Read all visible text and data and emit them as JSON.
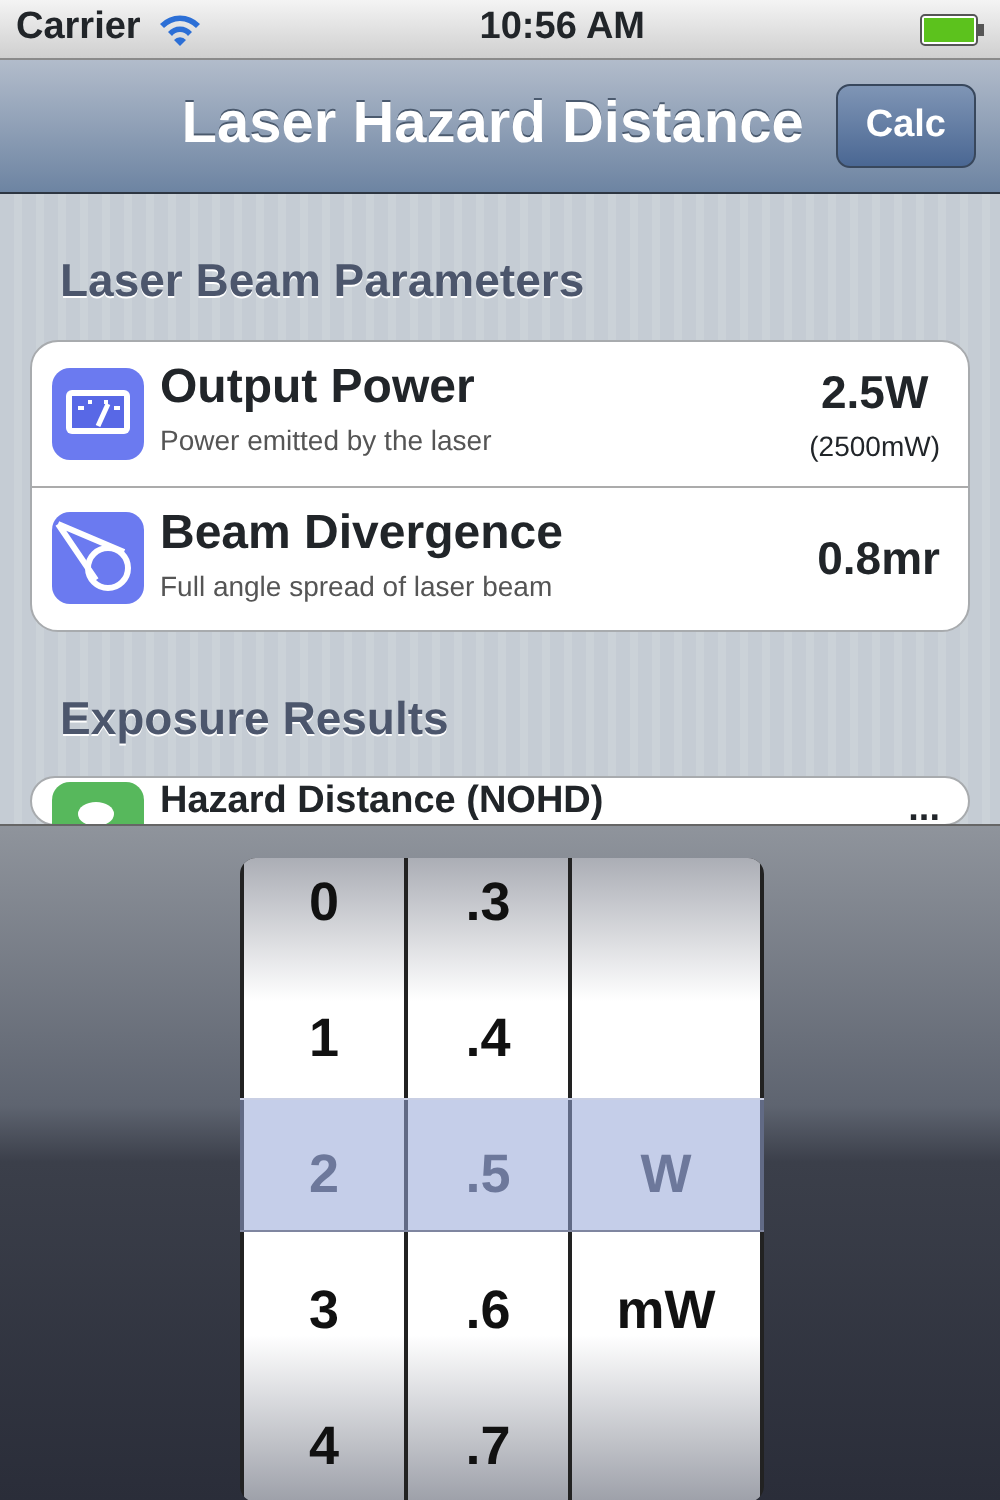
{
  "status_bar": {
    "carrier": "Carrier",
    "time": "10:56 AM"
  },
  "nav": {
    "title": "Laser Hazard Distance",
    "button": "Calc"
  },
  "sections": [
    {
      "header": "Laser Beam Parameters",
      "rows": [
        {
          "title": "Output Power",
          "subtitle": "Power emitted by the laser",
          "value": "2.5W",
          "value_note": "(2500mW)"
        },
        {
          "title": "Beam Divergence",
          "subtitle": "Full angle spread of laser beam",
          "value": "0.8mr"
        }
      ]
    },
    {
      "header": "Exposure Results",
      "rows": [
        {
          "title": "Hazard Distance (NOHD)",
          "value": "..."
        }
      ]
    }
  ],
  "picker": {
    "columns": [
      {
        "items": [
          {
            "label": "0",
            "selected": false
          },
          {
            "label": "1",
            "selected": false
          },
          {
            "label": "2",
            "selected": true
          },
          {
            "label": "3",
            "selected": false
          },
          {
            "label": "4",
            "selected": false
          }
        ]
      },
      {
        "items": [
          {
            "label": ".3",
            "selected": false
          },
          {
            "label": ".4",
            "selected": false
          },
          {
            "label": ".5",
            "selected": true
          },
          {
            "label": ".6",
            "selected": false
          },
          {
            "label": ".7",
            "selected": false
          }
        ]
      },
      {
        "items": [
          {
            "label": "W",
            "selected": true
          },
          {
            "label": "mW",
            "selected": false
          }
        ]
      }
    ]
  }
}
